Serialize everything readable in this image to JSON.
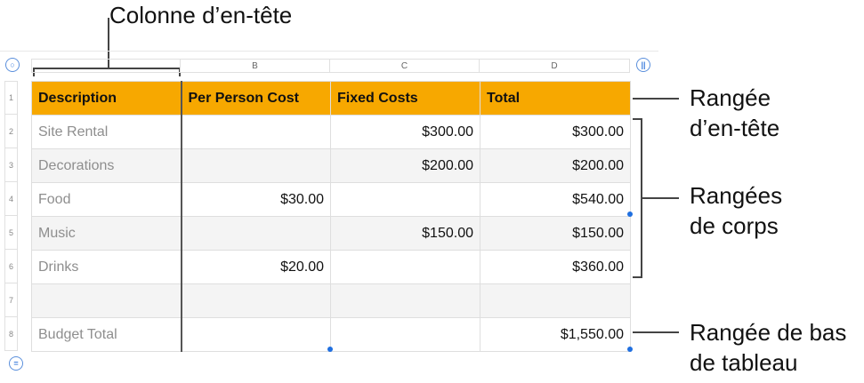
{
  "callouts": {
    "header_column": "Colonne d’en-tête",
    "header_row_line1": "Rangée",
    "header_row_line2": "d’en-tête",
    "body_rows_line1": "Rangées",
    "body_rows_line2": "de corps",
    "footer_row_line1": "Rangée de bas",
    "footer_row_line2": "de tableau"
  },
  "column_letters": [
    "",
    "B",
    "C",
    "D"
  ],
  "row_numbers": [
    "1",
    "2",
    "3",
    "4",
    "5",
    "6",
    "7",
    "8"
  ],
  "controls": {
    "select_table": "○",
    "add_column": "||",
    "add_row": "="
  },
  "table": {
    "headers": [
      "Description",
      "Per Person Cost",
      "Fixed Costs",
      "Total"
    ],
    "rows": [
      [
        "Site Rental",
        "",
        "$300.00",
        "$300.00"
      ],
      [
        "Decorations",
        "",
        "$200.00",
        "$200.00"
      ],
      [
        "Food",
        "$30.00",
        "",
        "$540.00"
      ],
      [
        "Music",
        "",
        "$150.00",
        "$150.00"
      ],
      [
        "Drinks",
        "$20.00",
        "",
        "$360.00"
      ],
      [
        "",
        "",
        "",
        ""
      ]
    ],
    "footer": [
      "Budget Total",
      "",
      "",
      "$1,550.00"
    ]
  }
}
